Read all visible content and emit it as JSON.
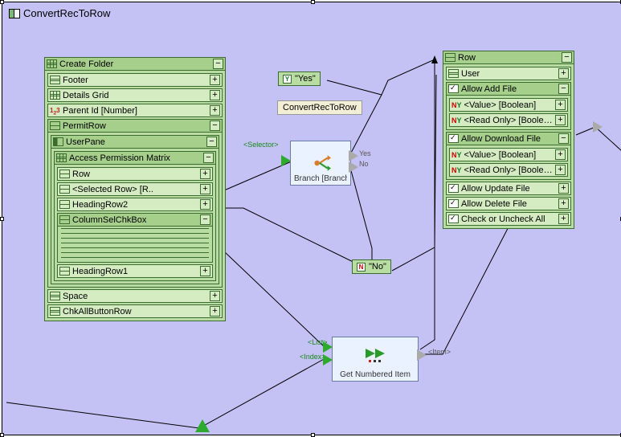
{
  "title": "ConvertRecToRow",
  "leftPanel": {
    "header": "Create Folder",
    "rows": {
      "footer": "Footer",
      "detailsGrid": "Details Grid",
      "parentId": "Parent Id [Number]",
      "permitRow": "PermitRow",
      "userPane": "UserPane",
      "matrix": "Access Permission Matrix",
      "row": "Row",
      "selectedRow": "<Selected Row> [R..",
      "headingRow2": "HeadingRow2",
      "columnSel": "ColumnSelChkBox",
      "headingRow1": "HeadingRow1",
      "space": "Space",
      "chkAll": "ChkAllButtonRow"
    }
  },
  "branch": {
    "caption": "ConvertRecToRow",
    "label": "Branch [Branch ..",
    "selectorPort": "<Selector>",
    "yesPort": "Yes",
    "noPort": "No"
  },
  "yesTag": "\"Yes\"",
  "noTag": "\"No\"",
  "getNumbered": {
    "label": "Get Numbered Item",
    "listPort": "<List>",
    "indexPort": "<Index>",
    "itemPort": "<Item>"
  },
  "rightPanel": {
    "header": "Row",
    "user": "User",
    "allowAdd": "Allow Add File",
    "value": "<Value> [Boolean]",
    "readOnly": "<Read Only> [Boolean]",
    "allowDownload": "Allow Download File",
    "allowUpdate": "Allow Update File",
    "allowDelete": "Allow Delete File",
    "checkAll": "Check or Uncheck All"
  }
}
